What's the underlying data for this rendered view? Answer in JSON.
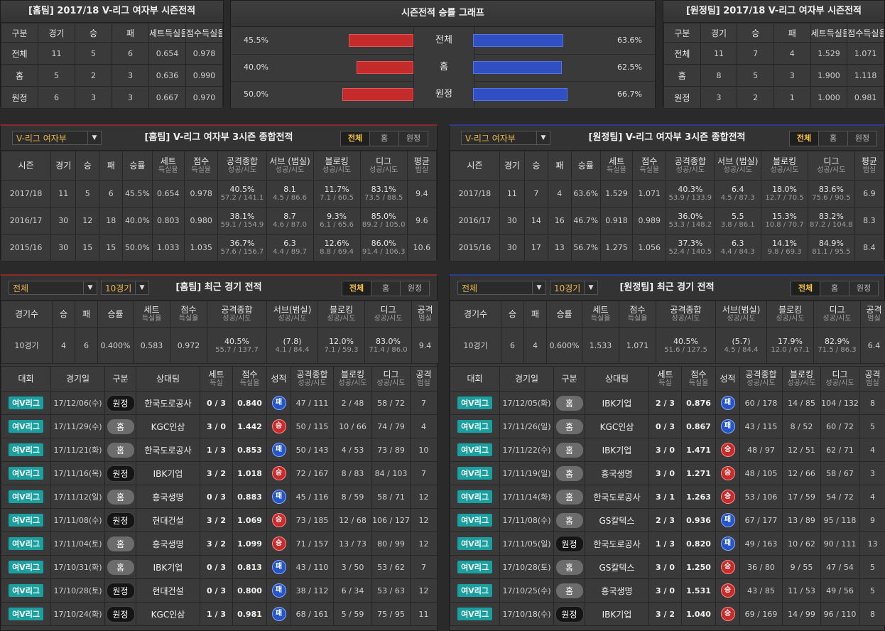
{
  "season_home": {
    "title": "[홈팀] 2017/18 V-리그 여자부 시즌전적",
    "headers": [
      "구분",
      "경기",
      "승",
      "패",
      "세트득실율",
      "점수득실율"
    ],
    "rows": [
      [
        "전체",
        "11",
        "5",
        "6",
        "0.654",
        "0.978"
      ],
      [
        "홈",
        "5",
        "2",
        "3",
        "0.636",
        "0.990"
      ],
      [
        "원정",
        "6",
        "3",
        "3",
        "0.667",
        "0.970"
      ]
    ]
  },
  "season_away": {
    "title": "[원정팀] 2017/18 V-리그 여자부 시즌전적",
    "headers": [
      "구분",
      "경기",
      "승",
      "패",
      "세트득실율",
      "점수득실율"
    ],
    "rows": [
      [
        "전체",
        "11",
        "7",
        "4",
        "1.529",
        "1.071"
      ],
      [
        "홈",
        "8",
        "5",
        "3",
        "1.900",
        "1.118"
      ],
      [
        "원정",
        "3",
        "2",
        "1",
        "1.000",
        "0.981"
      ]
    ]
  },
  "graph": {
    "title": "시즌전적 승률 그래프",
    "rows": [
      {
        "label": "전체",
        "home_pct": "45.5%",
        "away_pct": "63.6%",
        "home_val": 45.5,
        "away_val": 63.6
      },
      {
        "label": "홈",
        "home_pct": "40.0%",
        "away_pct": "62.5%",
        "home_val": 40.0,
        "away_val": 62.5
      },
      {
        "label": "원정",
        "home_pct": "50.0%",
        "away_pct": "66.7%",
        "home_val": 50.0,
        "away_val": 66.7
      }
    ],
    "colors": {
      "home": "#c52b2b",
      "away": "#2f4fc2"
    }
  },
  "tabs": {
    "all": "전체",
    "home": "홈",
    "away": "원정"
  },
  "three_home": {
    "select": "V-리그 여자부",
    "title": "[홈팀] V-리그 여자부 3시즌 종합전적",
    "headers": [
      [
        "시즌",
        ""
      ],
      [
        "경기",
        ""
      ],
      [
        "승",
        ""
      ],
      [
        "패",
        ""
      ],
      [
        "승률",
        ""
      ],
      [
        "세트",
        "득실율"
      ],
      [
        "점수",
        "득실율"
      ],
      [
        "공격종합",
        "성공/시도"
      ],
      [
        "서브 (범실)",
        "성공/시도"
      ],
      [
        "블로킹",
        "성공/시도"
      ],
      [
        "디그",
        "성공/시도"
      ],
      [
        "평균",
        "범실"
      ]
    ],
    "rows": [
      [
        "2017/18",
        "11",
        "5",
        "6",
        "45.5%",
        "0.654",
        "0.978",
        [
          "40.5%",
          "57.2 / 141.1"
        ],
        [
          "8.1",
          "4.5 / 86.6"
        ],
        [
          "11.7%",
          "7.1 / 60.5"
        ],
        [
          "83.1%",
          "73.5 / 88.5"
        ],
        "9.4"
      ],
      [
        "2016/17",
        "30",
        "12",
        "18",
        "40.0%",
        "0.803",
        "0.980",
        [
          "38.1%",
          "59.1 / 154.9"
        ],
        [
          "8.7",
          "4.6 / 87.0"
        ],
        [
          "9.3%",
          "6.1 / 65.6"
        ],
        [
          "85.0%",
          "89.2 / 105.0"
        ],
        "9.6"
      ],
      [
        "2015/16",
        "30",
        "15",
        "15",
        "50.0%",
        "1.033",
        "1.035",
        [
          "36.7%",
          "57.6 / 156.7"
        ],
        [
          "6.3",
          "4.4 / 89.7"
        ],
        [
          "12.6%",
          "8.8 / 69.4"
        ],
        [
          "86.0%",
          "91.4 / 106.3"
        ],
        "10.6"
      ]
    ]
  },
  "three_away": {
    "select": "V-리그 여자부",
    "title": "[원정팀] V-리그 여자부 3시즌 종합전적",
    "headers": [
      [
        "시즌",
        ""
      ],
      [
        "경기",
        ""
      ],
      [
        "승",
        ""
      ],
      [
        "패",
        ""
      ],
      [
        "승률",
        ""
      ],
      [
        "세트",
        "득실율"
      ],
      [
        "점수",
        "득실율"
      ],
      [
        "공격종합",
        "성공/시도"
      ],
      [
        "서브 (범실)",
        "성공/시도"
      ],
      [
        "블로킹",
        "성공/시도"
      ],
      [
        "디그",
        "성공/시도"
      ],
      [
        "평균",
        "범실"
      ]
    ],
    "rows": [
      [
        "2017/18",
        "11",
        "7",
        "4",
        "63.6%",
        "1.529",
        "1.071",
        [
          "40.3%",
          "53.9 / 133.9"
        ],
        [
          "6.4",
          "4.5 / 87.3"
        ],
        [
          "18.0%",
          "12.7 / 70.5"
        ],
        [
          "83.6%",
          "75.6 / 90.5"
        ],
        "6.9"
      ],
      [
        "2016/17",
        "30",
        "14",
        "16",
        "46.7%",
        "0.918",
        "0.989",
        [
          "36.0%",
          "53.3 / 148.2"
        ],
        [
          "5.5",
          "3.8 / 86.1"
        ],
        [
          "15.3%",
          "10.8 / 70.7"
        ],
        [
          "83.2%",
          "87.2 / 104.8"
        ],
        "8.3"
      ],
      [
        "2015/16",
        "30",
        "17",
        "13",
        "56.7%",
        "1.275",
        "1.056",
        [
          "37.3%",
          "52.4 / 140.5"
        ],
        [
          "6.3",
          "4.4 / 84.3"
        ],
        [
          "14.1%",
          "9.8 / 69.3"
        ],
        [
          "84.9%",
          "81.1 / 95.5"
        ],
        "8.4"
      ]
    ]
  },
  "recent_home": {
    "select1": "전체",
    "select2": "10경기",
    "title": "[홈팀] 최근 경기 전적",
    "sum_headers": [
      [
        "경기수",
        ""
      ],
      [
        "승",
        ""
      ],
      [
        "패",
        ""
      ],
      [
        "승률",
        ""
      ],
      [
        "세트",
        "득실율"
      ],
      [
        "점수",
        "득실율"
      ],
      [
        "공격종합",
        "성공/시도"
      ],
      [
        "서브(범실)",
        "성공/시도"
      ],
      [
        "블로킹",
        "성공/시도"
      ],
      [
        "디그",
        "성공/시도"
      ],
      [
        "공격",
        "범실"
      ]
    ],
    "sum_row": [
      "10경기",
      "4",
      "6",
      "0.400%",
      "0.583",
      "0.972",
      [
        "40.5%",
        "55.7 / 137.7"
      ],
      [
        "(7.8)",
        "4.1 / 84.4"
      ],
      [
        "12.0%",
        "7.1 / 59.3"
      ],
      [
        "83.0%",
        "71.4 / 86.0"
      ],
      "9.4"
    ],
    "game_headers": [
      [
        "대회",
        ""
      ],
      [
        "경기일",
        ""
      ],
      [
        "구분",
        ""
      ],
      [
        "상대팀",
        ""
      ],
      [
        "세트",
        "득실"
      ],
      [
        "점수",
        "득실율"
      ],
      [
        "성적",
        ""
      ],
      [
        "공격종합",
        "성공/시도"
      ],
      [
        "블로킹",
        "성공/시도"
      ],
      [
        "디그",
        "성공/시도"
      ],
      [
        "공격",
        "범실"
      ]
    ],
    "games": [
      [
        "여V리그",
        "17/12/06(수)",
        "원정",
        "한국도로공사",
        "0 / 3",
        "0.840",
        "패",
        "47 / 111",
        "2 / 48",
        "58 / 72",
        "7"
      ],
      [
        "여V리그",
        "17/11/29(수)",
        "홈",
        "KGC인삼",
        "3 / 0",
        "1.442",
        "승",
        "50 / 115",
        "10 / 66",
        "74 / 79",
        "4"
      ],
      [
        "여V리그",
        "17/11/21(화)",
        "홈",
        "한국도로공사",
        "1 / 3",
        "0.853",
        "패",
        "50 / 143",
        "4 / 53",
        "73 / 89",
        "10"
      ],
      [
        "여V리그",
        "17/11/16(목)",
        "원정",
        "IBK기업",
        "3 / 2",
        "1.018",
        "승",
        "72 / 167",
        "8 / 83",
        "84 / 103",
        "7"
      ],
      [
        "여V리그",
        "17/11/12(일)",
        "홈",
        "흥국생명",
        "0 / 3",
        "0.883",
        "패",
        "45 / 116",
        "8 / 59",
        "58 / 71",
        "12"
      ],
      [
        "여V리그",
        "17/11/08(수)",
        "원정",
        "현대건설",
        "3 / 2",
        "1.069",
        "승",
        "73 / 185",
        "12 / 68",
        "106 / 127",
        "12"
      ],
      [
        "여V리그",
        "17/11/04(토)",
        "홈",
        "흥국생명",
        "3 / 2",
        "1.099",
        "승",
        "71 / 157",
        "13 / 73",
        "80 / 99",
        "12"
      ],
      [
        "여V리그",
        "17/10/31(화)",
        "홈",
        "IBK기업",
        "0 / 3",
        "0.813",
        "패",
        "43 / 110",
        "3 / 50",
        "53 / 62",
        "7"
      ],
      [
        "여V리그",
        "17/10/28(토)",
        "원정",
        "현대건설",
        "0 / 3",
        "0.800",
        "패",
        "38 / 112",
        "6 / 34",
        "53 / 63",
        "12"
      ],
      [
        "여V리그",
        "17/10/24(화)",
        "원정",
        "KGC인삼",
        "1 / 3",
        "0.981",
        "패",
        "68 / 161",
        "5 / 59",
        "75 / 95",
        "11"
      ]
    ]
  },
  "recent_away": {
    "select1": "전체",
    "select2": "10경기",
    "title": "[원정팀] 최근 경기 전적",
    "sum_headers": [
      [
        "경기수",
        ""
      ],
      [
        "승",
        ""
      ],
      [
        "패",
        ""
      ],
      [
        "승률",
        ""
      ],
      [
        "세트",
        "득실율"
      ],
      [
        "점수",
        "득실율"
      ],
      [
        "공격종합",
        "성공/시도"
      ],
      [
        "서브(범실)",
        "성공/시도"
      ],
      [
        "블로킹",
        "성공/시도"
      ],
      [
        "디그",
        "성공/시도"
      ],
      [
        "공격",
        "범실"
      ]
    ],
    "sum_row": [
      "10경기",
      "6",
      "4",
      "0.600%",
      "1.533",
      "1.071",
      [
        "40.5%",
        "51.6 / 127.5"
      ],
      [
        "(5.7)",
        "4.5 / 84.4"
      ],
      [
        "17.9%",
        "12.0 / 67.1"
      ],
      [
        "82.9%",
        "71.5 / 86.3"
      ],
      "6.4"
    ],
    "game_headers": [
      [
        "대회",
        ""
      ],
      [
        "경기일",
        ""
      ],
      [
        "구분",
        ""
      ],
      [
        "상대팀",
        ""
      ],
      [
        "세트",
        "득실"
      ],
      [
        "점수",
        "득실율"
      ],
      [
        "성적",
        ""
      ],
      [
        "공격종합",
        "성공/시도"
      ],
      [
        "블로킹",
        "성공/시도"
      ],
      [
        "디그",
        "성공/시도"
      ],
      [
        "공격",
        "범실"
      ]
    ],
    "games": [
      [
        "여V리그",
        "17/12/05(화)",
        "홈",
        "IBK기업",
        "2 / 3",
        "0.876",
        "패",
        "60 / 178",
        "14 / 85",
        "104 / 132",
        "8"
      ],
      [
        "여V리그",
        "17/11/26(일)",
        "홈",
        "KGC인삼",
        "0 / 3",
        "0.867",
        "패",
        "43 / 115",
        "8 / 52",
        "60 / 72",
        "5"
      ],
      [
        "여V리그",
        "17/11/22(수)",
        "홈",
        "IBK기업",
        "3 / 0",
        "1.471",
        "승",
        "48 / 97",
        "12 / 51",
        "62 / 71",
        "4"
      ],
      [
        "여V리그",
        "17/11/19(일)",
        "홈",
        "흥국생명",
        "3 / 0",
        "1.271",
        "승",
        "48 / 105",
        "12 / 66",
        "58 / 67",
        "3"
      ],
      [
        "여V리그",
        "17/11/14(화)",
        "홈",
        "한국도로공사",
        "3 / 1",
        "1.263",
        "승",
        "53 / 106",
        "17 / 59",
        "54 / 72",
        "4"
      ],
      [
        "여V리그",
        "17/11/08(수)",
        "홈",
        "GS칼텍스",
        "2 / 3",
        "0.936",
        "패",
        "67 / 177",
        "13 / 89",
        "95 / 118",
        "9"
      ],
      [
        "여V리그",
        "17/11/05(일)",
        "원정",
        "한국도로공사",
        "1 / 3",
        "0.820",
        "패",
        "49 / 163",
        "10 / 62",
        "90 / 111",
        "13"
      ],
      [
        "여V리그",
        "17/10/28(토)",
        "홈",
        "GS칼텍스",
        "3 / 0",
        "1.250",
        "승",
        "36 / 80",
        "9 / 55",
        "47 / 54",
        "5"
      ],
      [
        "여V리그",
        "17/10/25(수)",
        "홈",
        "흥국생명",
        "3 / 0",
        "1.531",
        "승",
        "43 / 85",
        "11 / 53",
        "49 / 56",
        "5"
      ],
      [
        "여V리그",
        "17/10/18(수)",
        "원정",
        "IBK기업",
        "3 / 2",
        "1.040",
        "승",
        "69 / 169",
        "14 / 99",
        "96 / 110",
        "8"
      ]
    ]
  }
}
